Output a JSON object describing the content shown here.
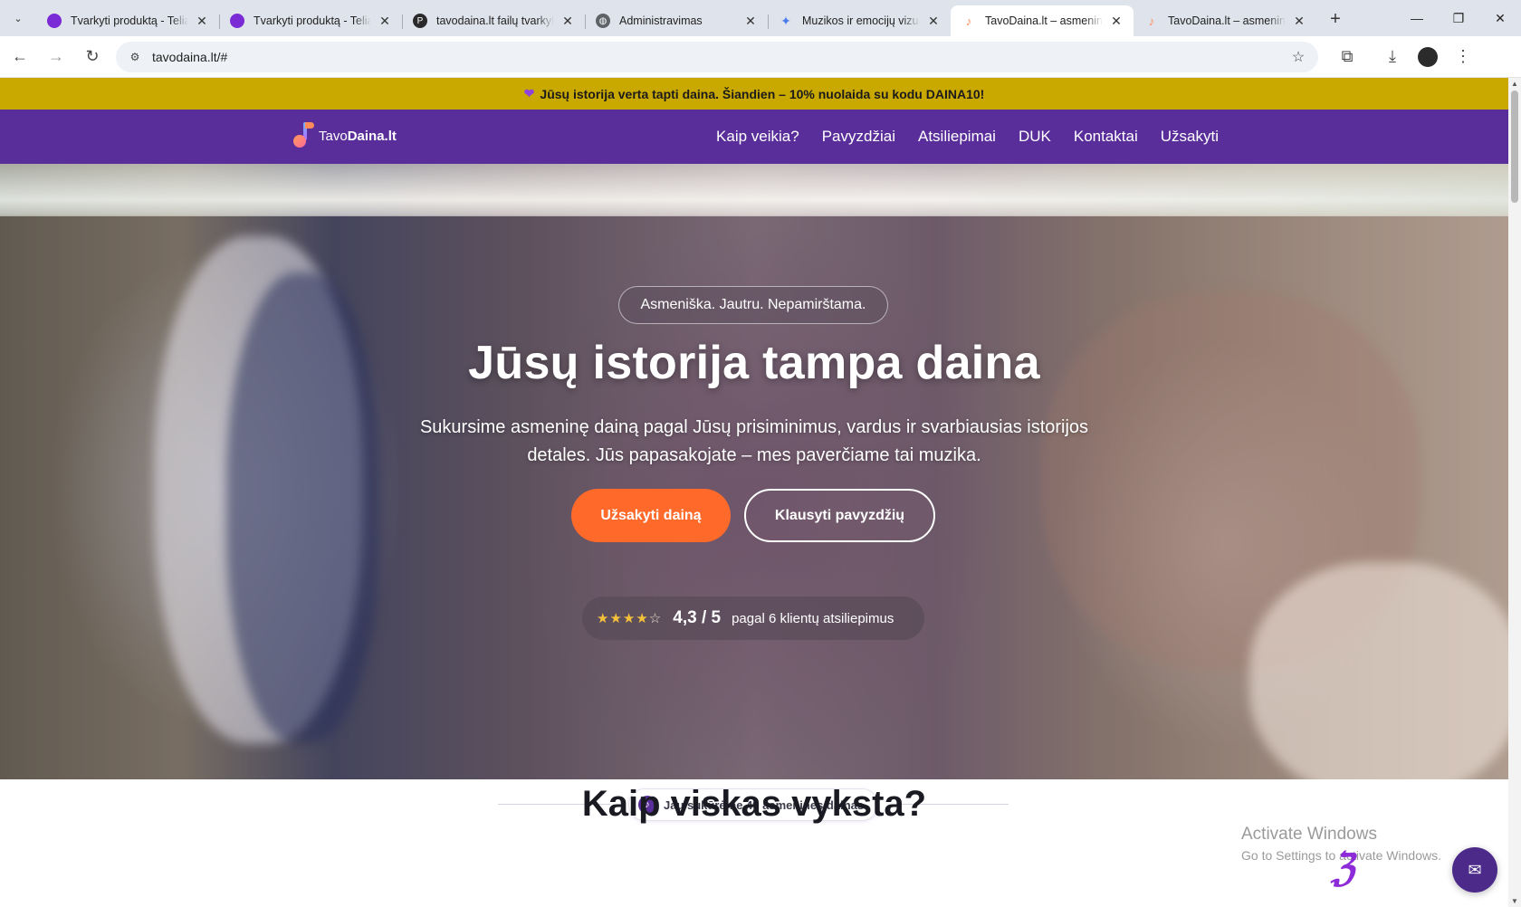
{
  "browser": {
    "tabs": [
      {
        "title": "Tvarkyti produktą - Telia",
        "favicon": "purple-sphere-icon",
        "color": "#7b2bd6"
      },
      {
        "title": "Tvarkyti produktą - Telia",
        "favicon": "purple-sphere-icon",
        "color": "#7b2bd6"
      },
      {
        "title": "tavodaina.lt failų tvarkykl",
        "favicon": "p-logo-icon",
        "color": "#2a2a2a"
      },
      {
        "title": "Administravimas",
        "favicon": "globe-icon",
        "color": "#5f6368"
      },
      {
        "title": "Muzikos ir emocijų vizual",
        "favicon": "gemini-sparkle-icon",
        "color": "#4a7cf0"
      },
      {
        "title": "TavoDaina.lt – asmeninė",
        "favicon": "tavodaina-icon",
        "color": "#ff8a5a"
      },
      {
        "title": "TavoDaina.lt – asmeninė",
        "favicon": "tavodaina-icon",
        "color": "#ff8a5a"
      }
    ],
    "active_tab": 5,
    "url": "tavodaina.lt/#"
  },
  "promo": {
    "icon": "purple-heart-icon",
    "text": "Jūsų istorija verta tapti daina. Šiandien – 10% nuolaida su kodu DAINA10!"
  },
  "nav": {
    "logo_light": "Tavo",
    "logo_bold": "Daina.lt",
    "items": [
      "Kaip veikia?",
      "Pavyzdžiai",
      "Atsiliepimai",
      "DUK",
      "Kontaktai",
      "Užsakyti"
    ]
  },
  "hero": {
    "badge": "Asmeniška. Jautru. Nepamirštama.",
    "title": "Jūsų istorija tampa daina",
    "subtitle": "Sukursime asmeninę dainą pagal Jūsų prisiminimus, vardus ir svarbiausias istorijos detales. Jūs papasakojate – mes paverčiame tai muzika.",
    "cta_primary": "Užsakyti dainą",
    "cta_secondary": "Klausyti pavyzdžių",
    "rating": {
      "stars_filled": "★★★★",
      "stars_empty": "☆",
      "score": "4,3 / 5",
      "count_text": "pagal 6 klientų atsiliepimus"
    }
  },
  "stats": {
    "text": "Jau sukūrėme 49 asmenines dainas"
  },
  "section": {
    "title": "Kaip viskas vyksta?"
  },
  "windows_watermark": {
    "line1": "Activate Windows",
    "line2": "Go to Settings to activate Windows."
  },
  "colors": {
    "promo_bg": "#c9a800",
    "nav_bg": "#5a2e9a",
    "cta_primary": "#ff6a2b",
    "star": "#f5c13a"
  }
}
